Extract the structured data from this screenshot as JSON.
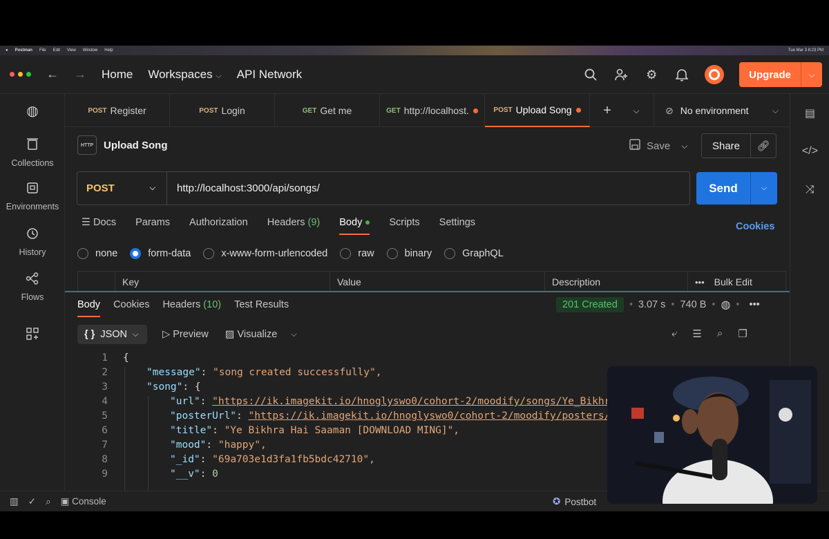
{
  "menubar": {
    "app": "Postman",
    "items": [
      "File",
      "Edit",
      "View",
      "Window",
      "Help"
    ],
    "clock": "Tue Mar 3 8:23 PM"
  },
  "header": {
    "home": "Home",
    "workspaces": "Workspaces",
    "api_network": "API Network",
    "upgrade": "Upgrade",
    "accent": "#ff6c37"
  },
  "sidebar": {
    "items": [
      {
        "label": "Collections",
        "icon": "trash-icon"
      },
      {
        "label": "Environments",
        "icon": "environment-icon"
      },
      {
        "label": "History",
        "icon": "history-icon"
      },
      {
        "label": "Flows",
        "icon": "flows-icon"
      }
    ]
  },
  "tabs": [
    {
      "method": "POST",
      "label": "Register"
    },
    {
      "method": "POST",
      "label": "Login"
    },
    {
      "method": "GET",
      "label": "Get me"
    },
    {
      "method": "GET",
      "label": "http://localhost."
    },
    {
      "method": "POST",
      "label": "Upload Song"
    }
  ],
  "environment": "No environment",
  "request": {
    "icon_text": "HTTP",
    "title": "Upload Song",
    "save": "Save",
    "share": "Share",
    "method": "POST",
    "url": "http://localhost:3000/api/songs/",
    "send": "Send"
  },
  "req_tabs": {
    "docs": "Docs",
    "params": "Params",
    "authorization": "Authorization",
    "headers": "Headers",
    "headers_count": "(9)",
    "body": "Body",
    "scripts": "Scripts",
    "settings": "Settings",
    "cookies": "Cookies"
  },
  "body_types": [
    "none",
    "form-data",
    "x-www-form-urlencoded",
    "raw",
    "binary",
    "GraphQL"
  ],
  "kv_table": {
    "key": "Key",
    "value": "Value",
    "description": "Description",
    "bulk_edit": "Bulk Edit"
  },
  "response": {
    "tabs": {
      "body": "Body",
      "cookies": "Cookies",
      "headers": "Headers",
      "headers_count": "(10)",
      "test_results": "Test Results"
    },
    "status": "201 Created",
    "time": "3.07 s",
    "size": "740 B",
    "format": "JSON",
    "preview": "Preview",
    "visualize": "Visualize",
    "lines": [
      {
        "n": "1",
        "text": "{"
      },
      {
        "n": "2",
        "key": "\"message\"",
        "value": "\"song created successfully\","
      },
      {
        "n": "3",
        "key": "\"song\"",
        "value": "{"
      },
      {
        "n": "4",
        "key": "\"url\"",
        "value": "\"https://ik.imagekit.io/hnoglyswo0/cohort-2/moodify/songs/Ye_Bikhra_"
      },
      {
        "n": "5",
        "key": "\"posterUrl\"",
        "value": "\"https://ik.imagekit.io/hnoglyswo0/cohort-2/moodify/posters/Ye"
      },
      {
        "n": "6",
        "key": "\"title\"",
        "value": "\"Ye Bikhra Hai Saaman [DOWNLOAD MING]\","
      },
      {
        "n": "7",
        "key": "\"mood\"",
        "value": "\"happy\","
      },
      {
        "n": "8",
        "key": "\"_id\"",
        "value": "\"69a703e1d3fa1fb5bdc42710\","
      },
      {
        "n": "9",
        "key": "\"__v\"",
        "value": "0"
      }
    ]
  },
  "footer": {
    "console": "Console",
    "postbot": "Postbot"
  }
}
